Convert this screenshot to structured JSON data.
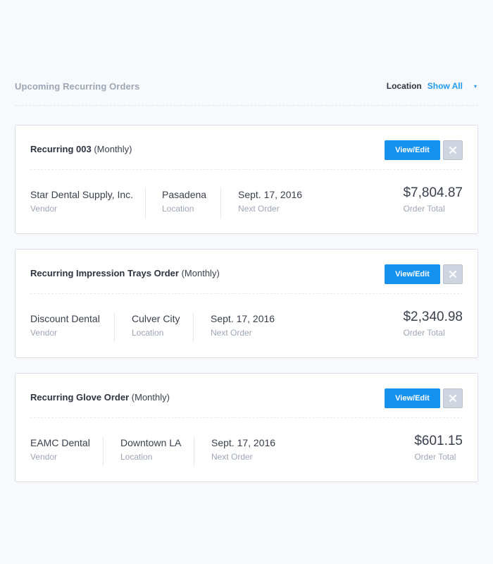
{
  "header": {
    "title": "Upcoming Recurring Orders",
    "location_label": "Location",
    "location_value": "Show All",
    "caret": "▾"
  },
  "labels": {
    "view_edit": "View/Edit",
    "vendor": "Vendor",
    "location": "Location",
    "next_order": "Next Order",
    "order_total": "Order Total"
  },
  "orders": [
    {
      "name": "Recurring 003",
      "frequency": "(Monthly)",
      "vendor": "Star Dental Supply, Inc.",
      "location": "Pasadena",
      "next_order": "Sept. 17, 2016",
      "total": "$7,804.87"
    },
    {
      "name": "Recurring Impression Trays Order",
      "frequency": "(Monthly)",
      "vendor": "Discount Dental",
      "location": "Culver City",
      "next_order": "Sept. 17, 2016",
      "total": "$2,340.98"
    },
    {
      "name": "Recurring Glove Order",
      "frequency": "(Monthly)",
      "vendor": "EAMC Dental",
      "location": "Downtown LA",
      "next_order": "Sept. 17, 2016",
      "total": "$601.15"
    }
  ],
  "icons": {
    "close": "close-icon",
    "caret": "chevron-down-icon"
  },
  "colors": {
    "accent": "#1592f0",
    "link": "#1f9bf0",
    "close_button": "#cfd5e0",
    "muted_text": "#9ea7b6",
    "background": "#f8f9fc"
  }
}
